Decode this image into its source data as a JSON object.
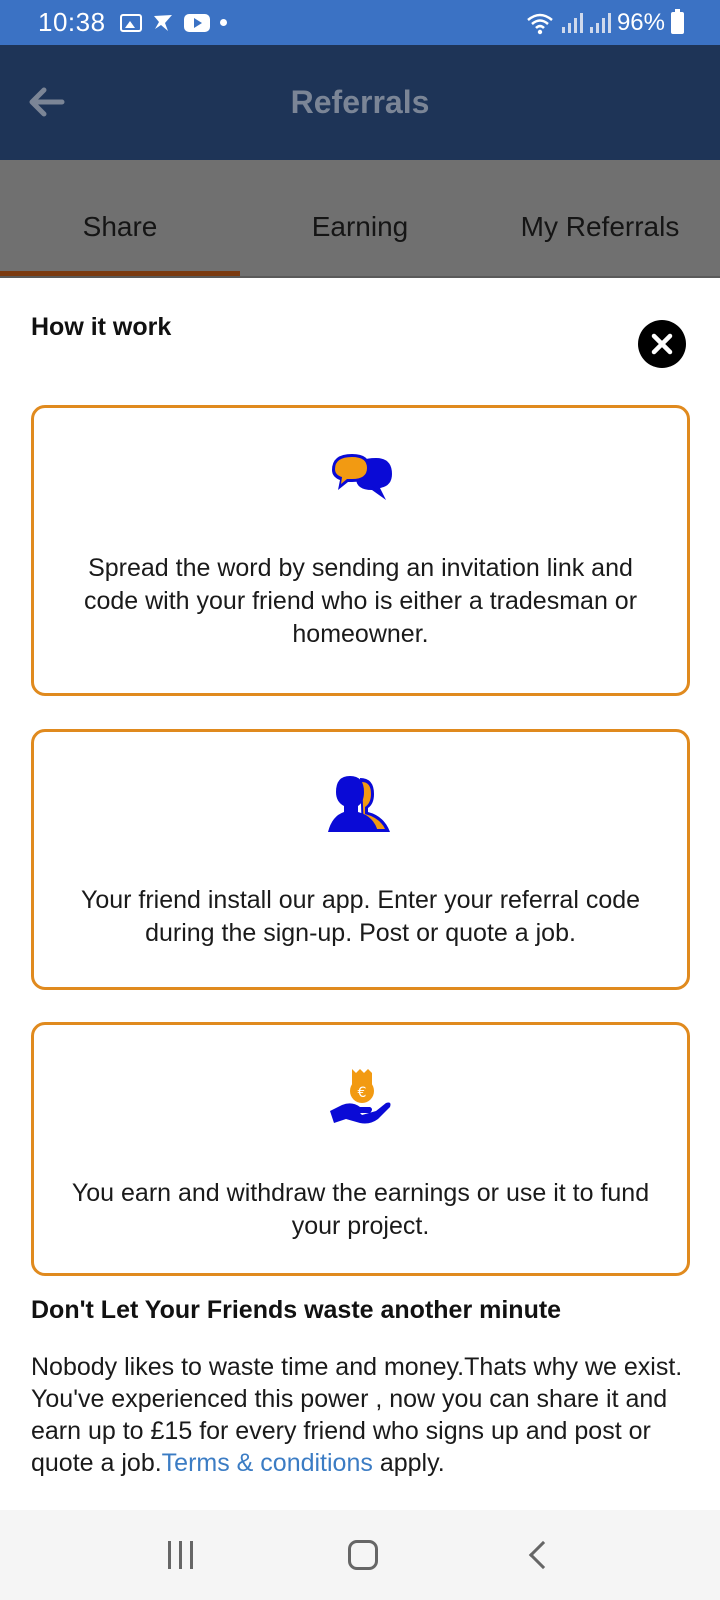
{
  "status_bar": {
    "time": "10:38",
    "battery": "96%"
  },
  "app_bar": {
    "title": "Referrals"
  },
  "tabs": [
    {
      "label": "Share",
      "active": true
    },
    {
      "label": "Earning",
      "active": false
    },
    {
      "label": "My Referrals",
      "active": false
    }
  ],
  "sheet": {
    "title": "How it work",
    "steps": [
      {
        "icon": "chat-bubbles-icon",
        "text": "Spread the word by sending an invitation link and code with your friend who is either a tradesman or homeowner."
      },
      {
        "icon": "users-icon",
        "text": "Your friend install our app. Enter your referral code during the sign-up. Post or quote a job."
      },
      {
        "icon": "money-hand-icon",
        "text": "You earn and withdraw the earnings or use it to fund your project."
      }
    ],
    "heading": "Don't Let Your Friends waste another minute",
    "paragraph_before_link": "Nobody likes to waste time and money.Thats why we exist. You've experienced this power , now you can share it and earn up to £15 for every friend who signs up and post or quote a job.",
    "link_text": "Terms & conditions",
    "paragraph_after_link": " apply."
  },
  "colors": {
    "status_bar": "#3b72c4",
    "app_bar": "#1e3457",
    "card_border": "#e08a1e",
    "icon_blue": "#0a0ad6",
    "icon_orange": "#f29a12",
    "link": "#3b7cc4"
  }
}
